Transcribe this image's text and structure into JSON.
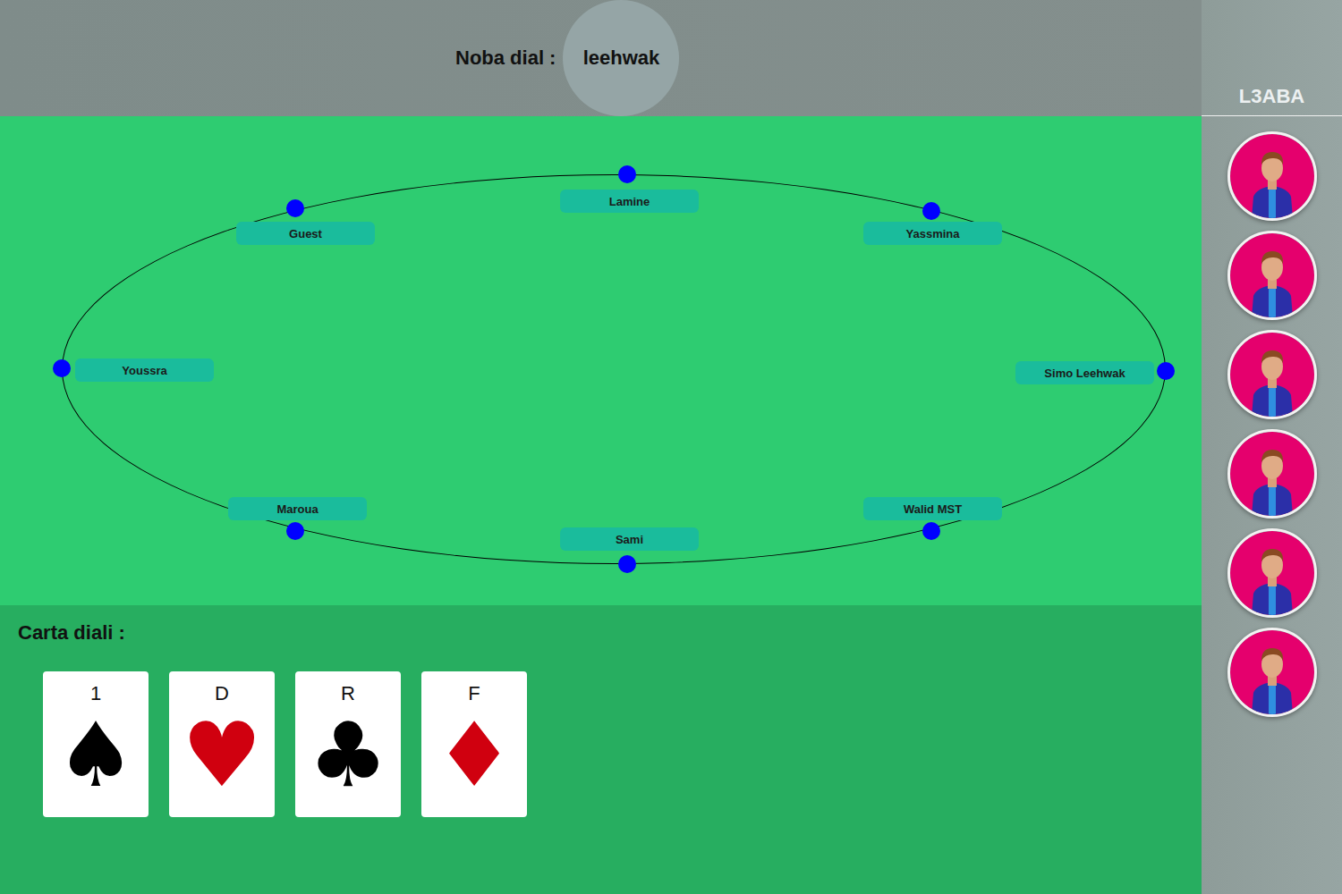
{
  "header": {
    "turn_label": "Noba dial :",
    "turn_player": "leehwak"
  },
  "table": {
    "players": [
      {
        "name": "Lamine"
      },
      {
        "name": "Yassmina"
      },
      {
        "name": "Simo Leehwak"
      },
      {
        "name": "Walid MST"
      },
      {
        "name": "Sami"
      },
      {
        "name": "Maroua"
      },
      {
        "name": "Youssra"
      },
      {
        "name": "Guest"
      }
    ]
  },
  "hand": {
    "title": "Carta diali :",
    "cards": [
      {
        "rank": "1",
        "suit": "♠",
        "color": "#000000"
      },
      {
        "rank": "D",
        "suit": "♥",
        "color": "#d0000f"
      },
      {
        "rank": "R",
        "suit": "♣",
        "color": "#000000"
      },
      {
        "rank": "F",
        "suit": "♦",
        "color": "#d0000f"
      }
    ]
  },
  "sidebar": {
    "title": "L3ABA",
    "avatar_count": 6
  }
}
